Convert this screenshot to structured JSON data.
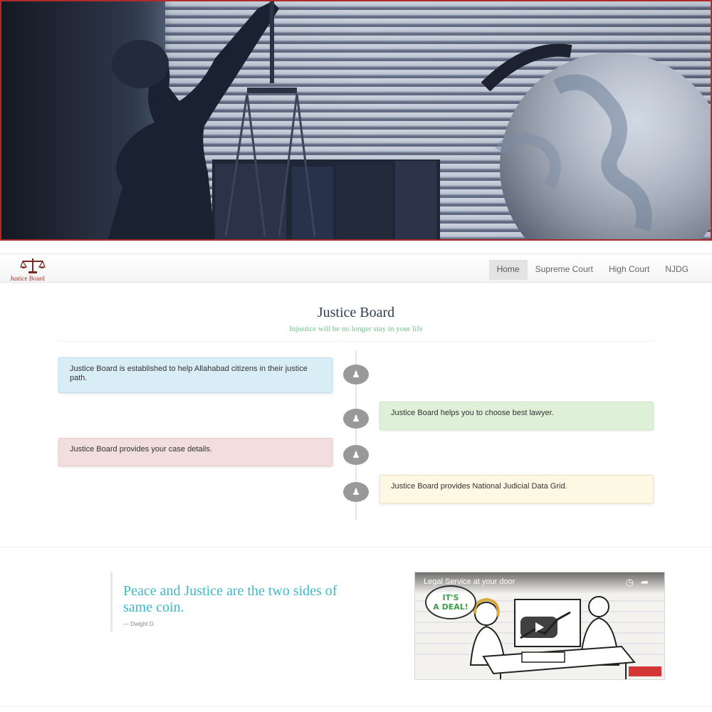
{
  "brand": {
    "name": "Justice Board"
  },
  "nav": {
    "items": [
      {
        "label": "Home",
        "active": true
      },
      {
        "label": "Supreme Court",
        "active": false
      },
      {
        "label": "High Court",
        "active": false
      },
      {
        "label": "NJDG",
        "active": false
      }
    ]
  },
  "header": {
    "title": "Justice Board",
    "tagline": "Injustice will be no longer stay in your life"
  },
  "timeline": {
    "icon": "chess-piece-icon",
    "events": [
      {
        "text": "Justice Board is established to help Allahabad citizens in their justice path.",
        "side": "left",
        "color": "#d9edf7"
      },
      {
        "text": "Justice Board helps you to choose best lawyer.",
        "side": "right",
        "color": "#dff0d8"
      },
      {
        "text": "Justice Board provides your case details.",
        "side": "left",
        "color": "#f2dede"
      },
      {
        "text": "Justice Board provides National Judicial Data Grid.",
        "side": "right",
        "color": "#fcf8e3"
      }
    ]
  },
  "quote": {
    "text": "Peace and Justice are the two sides of same coin.",
    "author": "— Dwight D."
  },
  "video": {
    "title": "Legal Service at your door",
    "bubble": [
      "IT'S",
      "A DEAL!"
    ],
    "icons": [
      "clock-icon",
      "share-icon",
      "play-icon"
    ]
  },
  "colors": {
    "title": "#2c3d55",
    "tagline": "#6fc18f",
    "quote": "#3fb8c6",
    "hero_border": "#b02a2a"
  }
}
